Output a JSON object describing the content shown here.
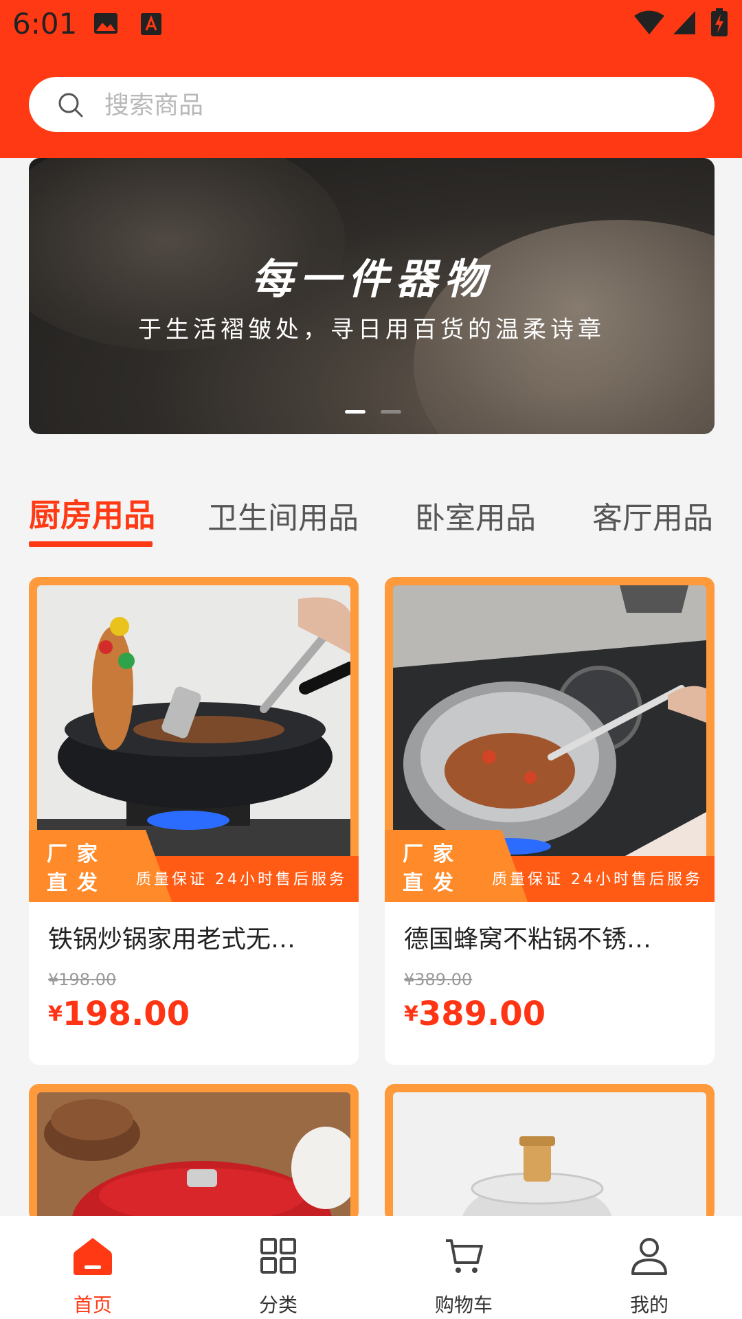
{
  "status_bar": {
    "time": "6:01"
  },
  "search": {
    "placeholder": "搜索商品"
  },
  "banner": {
    "title": "每一件器物",
    "subtitle": "于生活褶皱处，寻日用百货的温柔诗章",
    "active_index": 0,
    "slide_count": 2
  },
  "tabs": [
    "厨房用品",
    "卫生间用品",
    "卧室用品",
    "客厅用品"
  ],
  "active_tab": 0,
  "promo": {
    "tag_line1": "厂家",
    "tag_line2": "直发",
    "text": "质量保证 24小时售后服务"
  },
  "products": [
    {
      "name": "铁锅炒锅家用老式无…",
      "original_price": "¥198.00",
      "currency": "¥",
      "price": "198.00"
    },
    {
      "name": "德国蜂窝不粘锅不锈…",
      "original_price": "¥389.00",
      "currency": "¥",
      "price": "389.00"
    }
  ],
  "bottom_nav": {
    "items": [
      {
        "label": "首页",
        "icon": "home-icon"
      },
      {
        "label": "分类",
        "icon": "category-icon"
      },
      {
        "label": "购物车",
        "icon": "cart-icon"
      },
      {
        "label": "我的",
        "icon": "user-icon"
      }
    ],
    "active_index": 0
  },
  "colors": {
    "brand": "#ff3914",
    "promo_orange": "#ff8a2a",
    "price_red": "#ff3414"
  }
}
